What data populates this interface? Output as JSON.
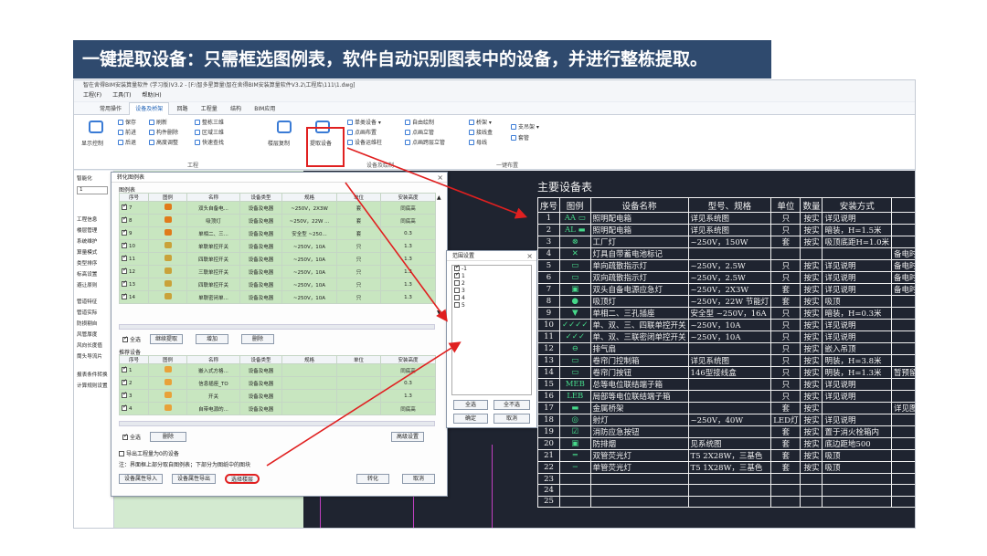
{
  "banner": "一键提取设备：只需框选图例表，软件自动识别图表中的设备，并进行整栋提取。",
  "window": {
    "title": "智在舍得BIM安装算量软件 (学习版)V3.2 - [F:\\智多星算量\\智在舍得BIM安装算量软件V3.2\\工程库\\111\\1.dwg]"
  },
  "menu": [
    "工程(F)",
    "工具(T)",
    "帮助(H)"
  ],
  "ribbon_tabs": [
    "常用操作",
    "设备及桥架",
    "回路",
    "工程量",
    "结构",
    "BIM应用"
  ],
  "ribbon": {
    "b1": "保存",
    "b2": "前进",
    "b3": "后退",
    "b4": "刷新",
    "b5": "构件删除",
    "b6": "高度调整",
    "b7": "整栋三维",
    "b8": "区域三维",
    "b9": "快速查找",
    "b10": "楼层复制",
    "show": "显示控制",
    "extract": "提取设备",
    "g1": "单类设备 ▾",
    "g2": "点画布置",
    "g3": "设备运维柱",
    "g4": "自由绘制",
    "g5": "点画立管",
    "g6": "点画跨层立管",
    "g7": "桥架 ▾",
    "g8": "接线盒",
    "g9": "母线",
    "g10": "支吊架 ▾",
    "g11": "套管",
    "grp_project": "工程",
    "grp_equip": "设备及绘制",
    "grp_layout": "一键布置"
  },
  "leftpanel": {
    "title": "智能化",
    "select": "1",
    "tree": [
      "工程信息",
      "楼层管理",
      "系统维护",
      "算量模式",
      "类型排序",
      "标高设置",
      "避让原则",
      "管道特征",
      "管道实际",
      "防损剔自",
      "风管厚度",
      "风向长度值",
      "筒头导流片",
      "报表条件转换",
      "计算规则设置"
    ]
  },
  "dialog1": {
    "title": "转化图例表",
    "section1": "图例表",
    "headers": [
      "序号",
      "图例",
      "名称",
      "设备类型",
      "规格",
      "单位",
      "安装高度"
    ],
    "rows": [
      {
        "no": "7",
        "name": "双头自备电...",
        "type": "设备及电器",
        "spec": "~250V，2X3W",
        "unit": "套",
        "h": "同底高"
      },
      {
        "no": "8",
        "name": "吸顶灯",
        "type": "设备及电器",
        "spec": "~250V，22W ...",
        "unit": "套",
        "h": "同底高"
      },
      {
        "no": "9",
        "name": "单相二、三...",
        "type": "设备及电器",
        "spec": "安全型 ~250...",
        "unit": "套",
        "h": "0.3"
      },
      {
        "no": "10",
        "name": "单联单控开关",
        "type": "设备及电器",
        "spec": "~250V，10A",
        "unit": "只",
        "h": "1.3"
      },
      {
        "no": "11",
        "name": "四联单控开关",
        "type": "设备及电器",
        "spec": "~250V，10A",
        "unit": "只",
        "h": "1.3"
      },
      {
        "no": "12",
        "name": "三联单控开关",
        "type": "设备及电器",
        "spec": "~250V，10A",
        "unit": "只",
        "h": "1.3"
      },
      {
        "no": "13",
        "name": "四联单控开关",
        "type": "设备及电器",
        "spec": "~250V，10A",
        "unit": "只",
        "h": "1.3"
      },
      {
        "no": "14",
        "name": "单联密闭单...",
        "type": "设备及电器",
        "spec": "~250V，10A",
        "unit": "只",
        "h": "1.3"
      }
    ],
    "buttons1": [
      "全选",
      "继续提取",
      "增加",
      "删除"
    ],
    "section2": "推荐设备",
    "rows2": [
      {
        "no": "1",
        "name": "嵌入式方格...",
        "type": "设备及电器",
        "spec": "",
        "unit": "",
        "h": "同底高"
      },
      {
        "no": "2",
        "name": "信息插座_TO",
        "type": "设备及电器",
        "spec": "",
        "unit": "",
        "h": "0.3"
      },
      {
        "no": "3",
        "name": "开关",
        "type": "设备及电器",
        "spec": "",
        "unit": "",
        "h": "1.3"
      },
      {
        "no": "4",
        "name": "自带电源的...",
        "type": "设备及电器",
        "spec": "",
        "unit": "",
        "h": "同底高"
      }
    ],
    "buttons2": [
      "全选",
      "删除"
    ],
    "advanced": "高级设置",
    "opt_export": "导出工程量为0的设备",
    "note": "注：界面框上部分取自图例表；下部分为图纸中的图块",
    "bottom": [
      "设备属性导入",
      "设备属性导出",
      "选择楼层",
      "转化",
      "取消"
    ]
  },
  "dialog2": {
    "title": "范围设置",
    "items": [
      "-1",
      "1",
      "2",
      "3",
      "4",
      "5"
    ],
    "buttons": [
      "全选",
      "全不选",
      "确定",
      "取消"
    ]
  },
  "equipment": {
    "title": "主要设备表",
    "headers": [
      "序号",
      "图例",
      "设备名称",
      "型号、规格",
      "单位",
      "数量",
      "安装方式",
      "备注"
    ],
    "rows": [
      [
        "1",
        "AA ▭",
        "照明配电箱",
        "详见系统图",
        "只",
        "按实",
        "详见说明",
        ""
      ],
      [
        "2",
        "AL ▬",
        "照明配电箱",
        "详见系统图",
        "只",
        "按实",
        "暗装，H=1.5米",
        ""
      ],
      [
        "3",
        "⊗",
        "工厂灯",
        "~250V，150W",
        "套",
        "按实",
        "吸顶底距H=1.0米",
        ""
      ],
      [
        "4",
        "✕",
        "灯具自带蓄电池标记",
        "",
        "",
        "",
        "",
        "备电时间详见说明"
      ],
      [
        "5",
        "▭",
        "单向疏散指示灯",
        "~250V，2.5W",
        "只",
        "按实",
        "详见说明",
        "备电时间≥90分钟"
      ],
      [
        "6",
        "▭",
        "双向疏散指示灯",
        "~250V，2.5W",
        "只",
        "按实",
        "详见说明",
        "备电时间≥90分钟"
      ],
      [
        "7",
        "▣",
        "双头自备电源应急灯",
        "~250V，2X3W",
        "套",
        "按实",
        "详见说明",
        "备电时间≥90分钟"
      ],
      [
        "8",
        "●",
        "吸顶灯",
        "~250V，22W 节能灯",
        "套",
        "按实",
        "吸顶",
        ""
      ],
      [
        "9",
        "▼",
        "单相二、三孔插座",
        "安全型 ~250V，16A",
        "只",
        "按实",
        "暗装，H=0.3米",
        ""
      ],
      [
        "10",
        "✓✓✓✓",
        "单、双、三、四联单控开关",
        "~250V，10A",
        "只",
        "按实",
        "详见说明",
        ""
      ],
      [
        "11",
        "✓✓✓",
        "单、双、三联密闭单控开关",
        "~250V，10A",
        "只",
        "按实",
        "详见说明",
        ""
      ],
      [
        "12",
        "⊖",
        "排气扇",
        "",
        "只",
        "按实",
        "嵌入吊顶",
        ""
      ],
      [
        "13",
        "▭",
        "卷帘门控制箱",
        "详见系统图",
        "只",
        "按实",
        "明装，H=3.8米",
        ""
      ],
      [
        "14",
        "▭",
        "卷帘门按钮",
        "146型接线盒",
        "只",
        "按实",
        "明装，H=1.3米",
        "暂预留"
      ],
      [
        "15",
        "MEB",
        "总等电位联结端子箱",
        "",
        "只",
        "按实",
        "详见说明",
        ""
      ],
      [
        "16",
        "LEB",
        "局部等电位联结端子箱",
        "",
        "只",
        "按实",
        "详见说明",
        ""
      ],
      [
        "17",
        "▬",
        "金属桥架",
        "",
        "套",
        "按实",
        "",
        "详见图纸标注"
      ],
      [
        "18",
        "◎",
        "射灯",
        "~250V，40W",
        "LED灯",
        "按实",
        "详见说明",
        ""
      ],
      [
        "19",
        "☑",
        "消防应急按钮",
        "",
        "套",
        "按实",
        "置于消火栓箱内",
        ""
      ],
      [
        "20",
        "▣",
        "防排烟",
        "见系统图",
        "套",
        "按实",
        "底边距地500",
        ""
      ],
      [
        "21",
        "═",
        "双管荧光灯",
        "T5  2X28W，三基色",
        "套",
        "按实",
        "吸顶",
        ""
      ],
      [
        "22",
        "─",
        "单管荧光灯",
        "T5  1X28W，三基色",
        "套",
        "按实",
        "吸顶",
        ""
      ],
      [
        "23",
        "",
        "",
        "",
        "",
        "",
        "",
        ""
      ],
      [
        "24",
        "",
        "",
        "",
        "",
        "",
        "",
        ""
      ],
      [
        "25",
        "",
        "",
        "",
        "",
        "",
        "",
        ""
      ]
    ]
  }
}
